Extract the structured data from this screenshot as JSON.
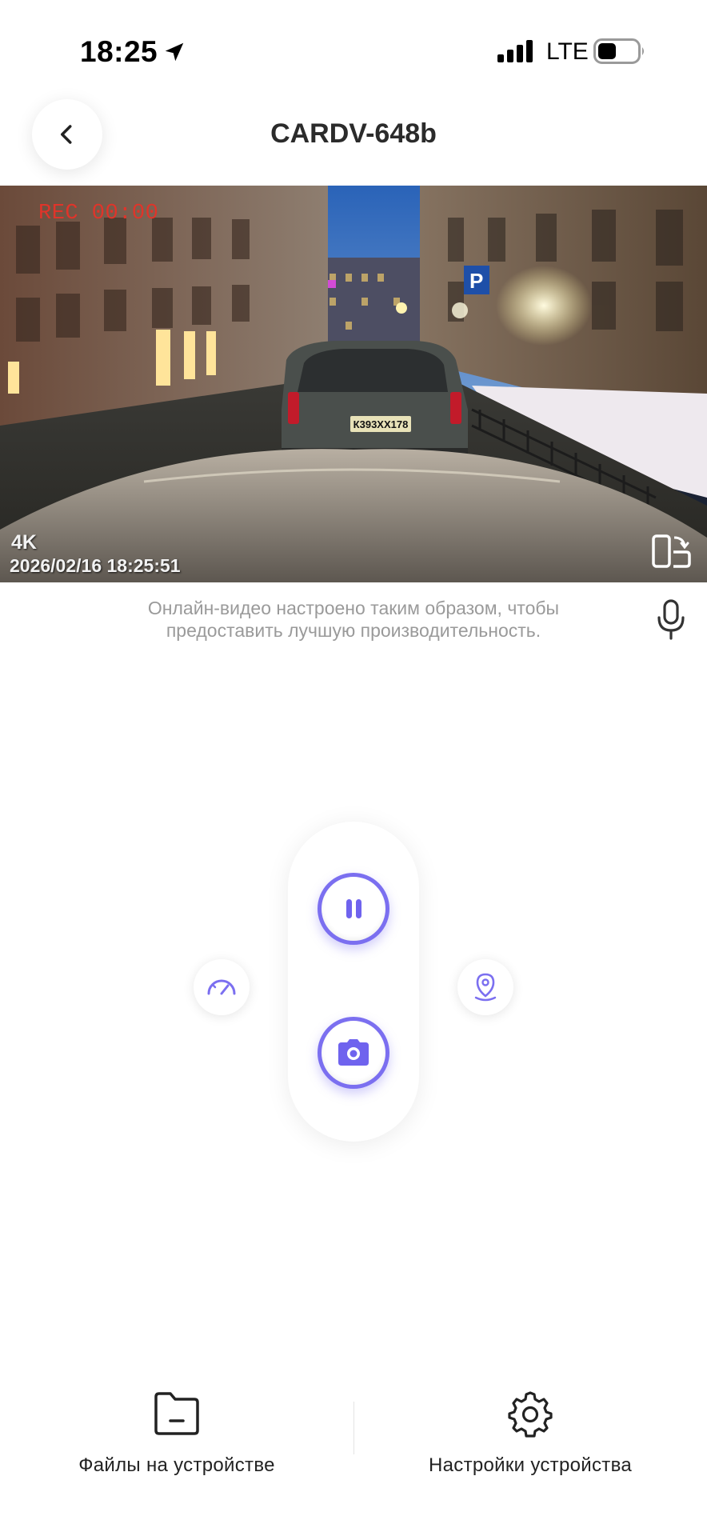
{
  "status_bar": {
    "time": "18:25",
    "network": "LTE",
    "icons": [
      "location-arrow-icon",
      "signal-bars-icon",
      "battery-icon"
    ]
  },
  "header": {
    "title": "CARDV-648b",
    "back_icon": "chevron-left-icon"
  },
  "video": {
    "rec_label": "REC  00:00",
    "resolution": "4K",
    "timestamp": "2026/02/16  18:25:51",
    "plate_text": "К393ХХ178",
    "rotate_icon": "rotate-screen-icon"
  },
  "info": {
    "message": "Онлайн-видео настроено таким образом, чтобы предоставить лучшую производительность.",
    "mic_icon": "microphone-icon"
  },
  "controls": {
    "pause_icon": "pause-icon",
    "capture_icon": "camera-icon",
    "speed_icon": "speedometer-icon",
    "location_icon": "map-pin-icon",
    "accent_color": "#7b6ff0"
  },
  "bottom_nav": {
    "files_label": "Файлы на устройстве",
    "settings_label": "Настройки устройства",
    "files_icon": "folder-icon",
    "settings_icon": "gear-icon"
  }
}
